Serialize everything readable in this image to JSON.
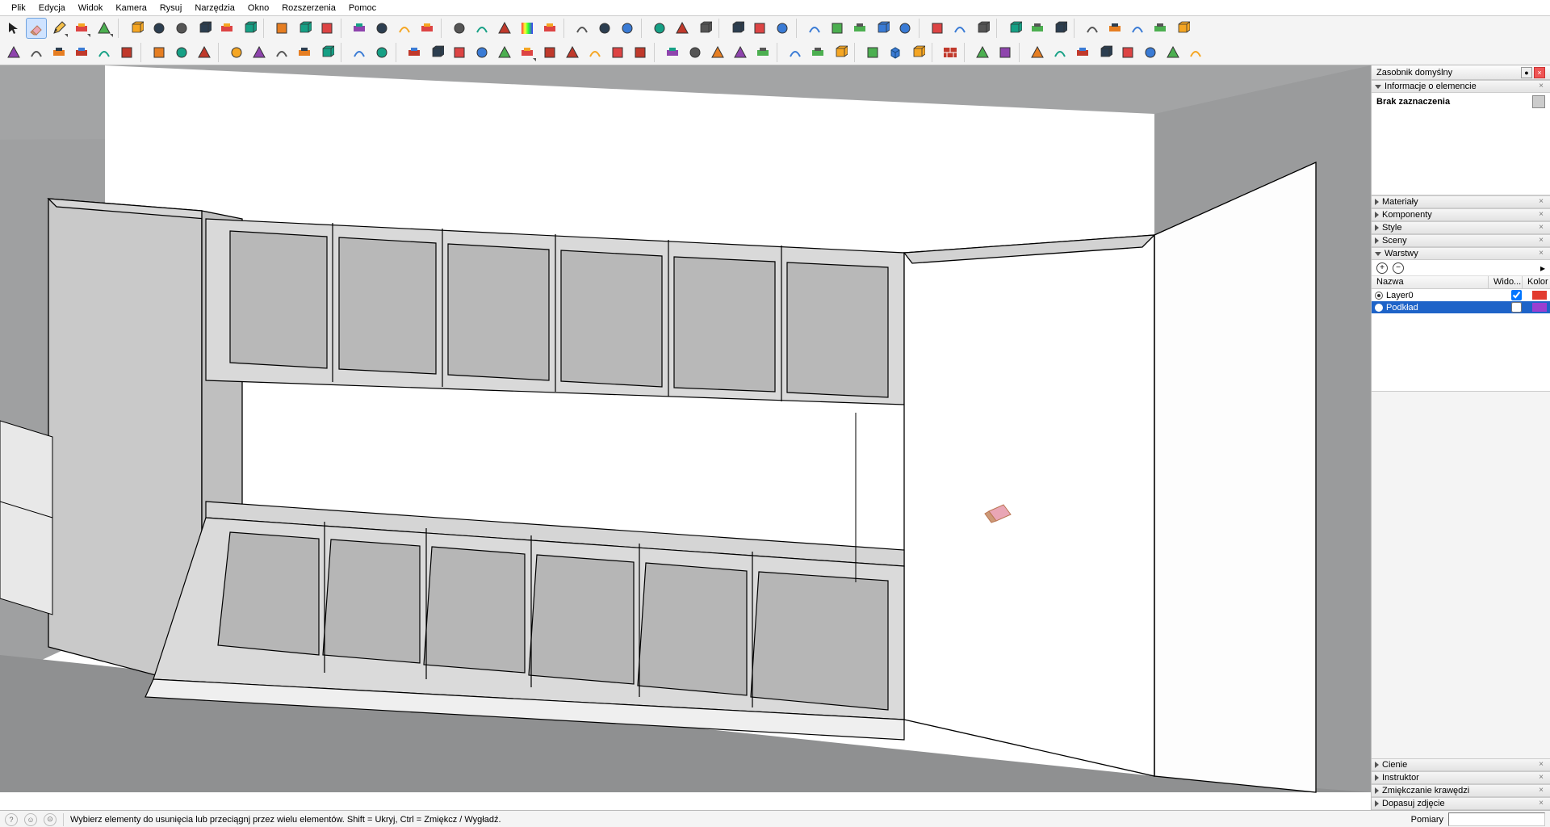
{
  "menu": [
    "Plik",
    "Edycja",
    "Widok",
    "Kamera",
    "Rysuj",
    "Narzędzia",
    "Okno",
    "Rozszerzenia",
    "Pomoc"
  ],
  "tray": {
    "title": "Zasobnik domyślny",
    "entity_panel": "Informacje o elemencie",
    "entity_status": "Brak zaznaczenia",
    "panels_top": [
      "Materiały",
      "Komponenty",
      "Style",
      "Sceny",
      "Warstwy"
    ],
    "panels_bottom": [
      "Cienie",
      "Instruktor",
      "Zmiękczanie krawędzi",
      "Dopasuj zdjęcie"
    ],
    "layers_head": {
      "name": "Nazwa",
      "visible": "Wido...",
      "color": "Kolor"
    },
    "layers": [
      {
        "name": "Layer0",
        "active": true,
        "visible": true,
        "color": "#e23b2e",
        "selected": false
      },
      {
        "name": "Podkład",
        "active": false,
        "visible": false,
        "color": "#9a3fd1",
        "selected": true
      }
    ]
  },
  "status": {
    "hint": "Wybierz elementy do usunięcia lub przeciągnj przez wielu elementów. Shift = Ukryj, Ctrl = Zmiękcz / Wygładź.",
    "measure_label": "Pomiary"
  },
  "icons": {
    "row1": [
      "select",
      "eraser",
      "pencil",
      "rect",
      "poly",
      "",
      "pushpull",
      "move",
      "rotate",
      "followme",
      "scale",
      "offset",
      "",
      "tape",
      "dimtext",
      "paint",
      "",
      "orbit",
      "pan",
      "zoom",
      "zoomext",
      "",
      "prev",
      "next",
      "pos",
      "rainbow",
      "eyedrop",
      "",
      "circle1",
      "kettle",
      "rect3",
      "",
      "panel1",
      "panel2",
      "lock",
      "",
      "arc1",
      "arc2",
      "arc3",
      "",
      "poly1",
      "sun",
      "poly2",
      "globe",
      "bulb",
      "",
      "box3d",
      "box3do",
      "boxes",
      "",
      "target",
      "dots",
      "grid9",
      "",
      "layers1",
      "layers2",
      "peel1",
      "peel2",
      "peel3"
    ],
    "row2": [
      "cube1",
      "cube2",
      "cube3",
      "slab",
      "sheet",
      "leaf",
      "",
      "img1",
      "img2",
      "img3",
      "",
      "sel1",
      "sel2",
      "sel3",
      "sel4",
      "sel5",
      "",
      "ball",
      "wrench2",
      "",
      "curve1",
      "curve2",
      "curve3",
      "curve4",
      "curve5",
      "arc",
      "sq",
      "sq2",
      "curve6",
      "zig",
      "pie",
      "",
      "zigline",
      "hex",
      "tool",
      "oval",
      "heart",
      "",
      "grid1",
      "grid2",
      "grid3",
      "",
      "diamond",
      "cubeblue",
      "cubedark",
      "",
      "brick",
      "",
      "sun2",
      "grid4",
      "",
      "ax1",
      "ax2",
      "ax3",
      "ax4",
      "ax5",
      "ax6",
      "ax7",
      "ax8"
    ]
  }
}
